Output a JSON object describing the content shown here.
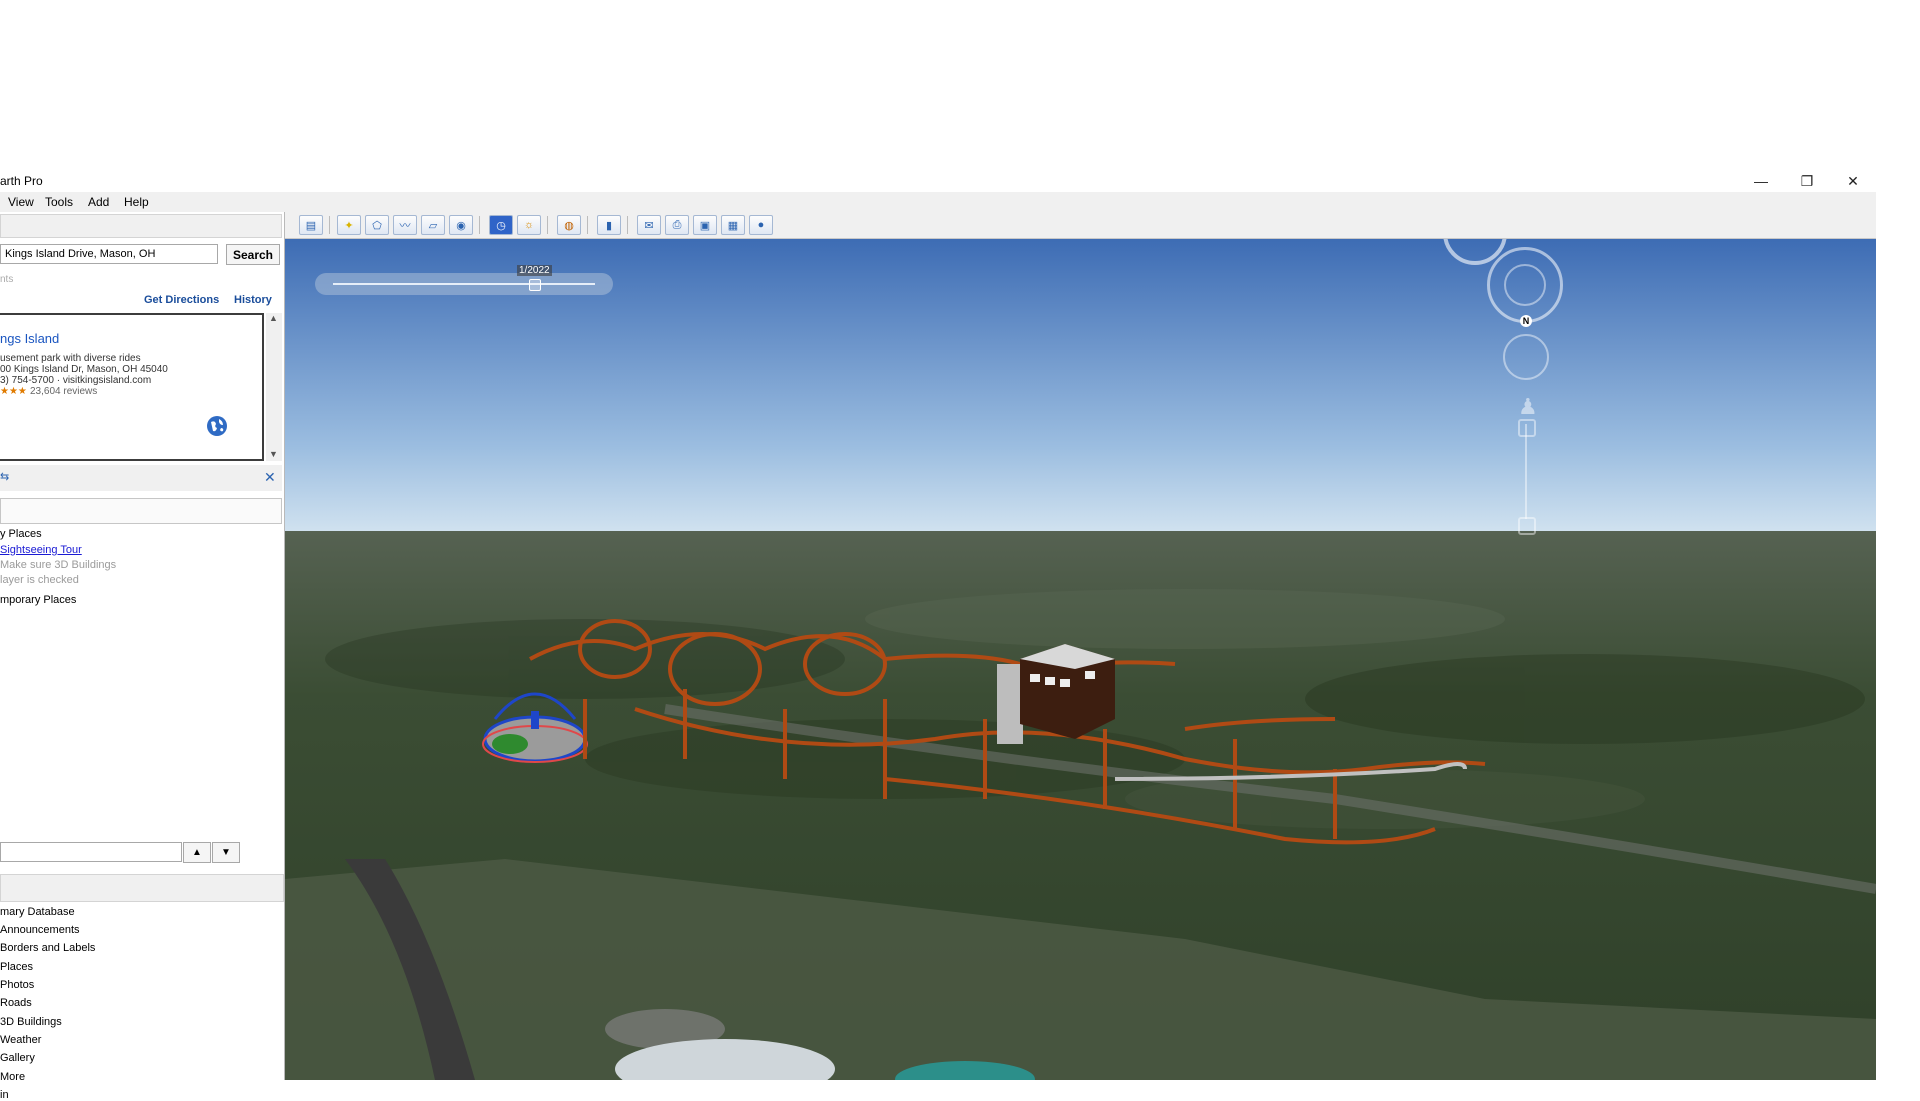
{
  "window": {
    "title": "arth Pro",
    "controls": {
      "minimize": "—",
      "restore": "❐",
      "close": "✕"
    }
  },
  "menu": [
    "View",
    "Tools",
    "Add",
    "Help"
  ],
  "search": {
    "value": "Kings Island Drive, Mason, OH",
    "button": "Search",
    "hint": "nts",
    "get_directions": "Get Directions",
    "history": "History"
  },
  "result": {
    "name": "ngs Island",
    "description": "usement park with diverse rides",
    "address": "00 Kings Island Dr, Mason, OH 45040",
    "phone_web": "3) 754-5700 · visitkingsisland.com",
    "stars": "★★★",
    "reviews": "23,604 reviews",
    "rating_fraction": 0.8
  },
  "places": {
    "my_places": "y Places",
    "tour_link": "Sightseeing Tour",
    "tour_note_1": "Make sure 3D Buildings",
    "tour_note_2": "layer is checked",
    "temporary": "mporary Places"
  },
  "layers": [
    "mary Database",
    "Announcements",
    "Borders and Labels",
    "Places",
    "Photos",
    "Roads",
    "3D Buildings",
    "Weather",
    "Gallery",
    "More",
    "in"
  ],
  "viewport": {
    "time_label": "1/2022",
    "compass_north": "N"
  },
  "colors": {
    "coaster": "#b04a14",
    "sky_top": "#3f6fb6",
    "sky_bottom": "#c9ddef",
    "terrain": "#3a4f32",
    "link": "#1a4d9b"
  },
  "icons": {
    "earth": "globe-icon",
    "close_places": "close-icon"
  }
}
